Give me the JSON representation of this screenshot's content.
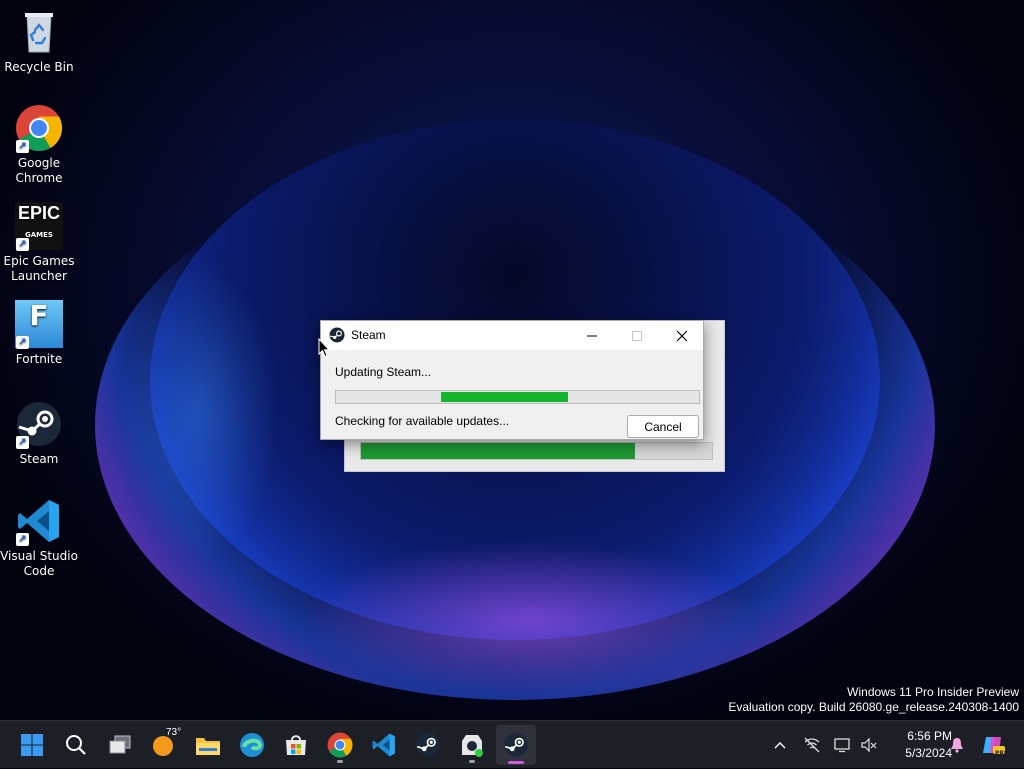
{
  "desktop": {
    "icons": [
      {
        "label": "Recycle Bin",
        "icon": "recycle-bin-icon"
      },
      {
        "label": "Google\nChrome",
        "icon": "chrome-icon"
      },
      {
        "label": "Epic Games\nLauncher",
        "icon": "epic-games-icon"
      },
      {
        "label": "Fortnite",
        "icon": "fortnite-icon"
      },
      {
        "label": "Steam",
        "icon": "steam-icon"
      },
      {
        "label": "Visual Studio\nCode",
        "icon": "vscode-icon"
      }
    ],
    "epic_logo_text": "EPIC",
    "epic_logo_sub": "GAMES",
    "fortnite_logo_text": "F"
  },
  "dialog": {
    "title": "Steam",
    "status": "Updating Steam...",
    "detail": "Checking for available updates...",
    "cancel_label": "Cancel",
    "progress": {
      "start": 0.29,
      "end": 0.64
    },
    "back_progress": 0.78
  },
  "watermark": {
    "line1": "Windows 11 Pro Insider Preview",
    "line2": "Evaluation copy. Build 26080.ge_release.240308-1400"
  },
  "taskbar": {
    "items": [
      "start-icon",
      "search-icon",
      "task-view-icon",
      "weather-icon",
      "file-explorer-icon",
      "edge-icon",
      "store-icon",
      "chrome-icon",
      "vscode-icon",
      "steam-icon",
      "steam-updater-icon",
      "steam-active-icon"
    ],
    "weather_temp": "73°",
    "clock": {
      "time": "6:56 PM",
      "date": "5/3/2024"
    },
    "tray": [
      "chevron-up-icon",
      "network-off-icon",
      "display-icon",
      "volume-muted-icon",
      "notification-bell-icon",
      "copilot-icon"
    ],
    "copilot_badge": "PRE"
  },
  "colors": {
    "progress_green": "#14b42f",
    "taskbar_bg": "#1d1f26",
    "active_indicator": "#cf5fd9"
  }
}
